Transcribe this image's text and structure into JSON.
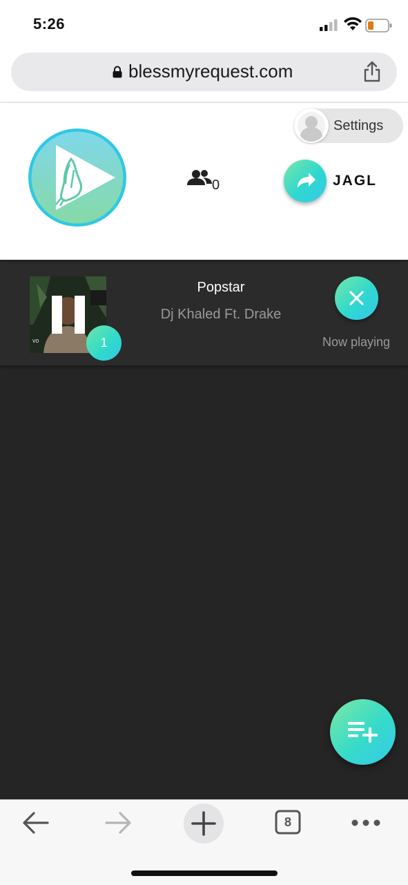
{
  "status_bar": {
    "time": "5:26"
  },
  "browser": {
    "url": "blessmyrequest.com",
    "tabs_count": "8"
  },
  "header": {
    "settings_label": "Settings",
    "listeners_count": "0",
    "room_code": "JAGL"
  },
  "now_playing": {
    "title": "Popstar",
    "artist": "Dj Khaled Ft. Drake",
    "queue_position": "1",
    "status": "Now playing"
  },
  "colors": {
    "accent_start": "#77e7a6",
    "accent_end": "#36c8ea",
    "logo": "#36c6e6",
    "dark_bg": "#252525"
  },
  "icons": [
    "lock-icon",
    "share-icon",
    "settings-avatar-icon",
    "app-logo-icon",
    "listeners-icon",
    "share-arrow-icon",
    "pause-icon",
    "close-icon",
    "add-to-queue-icon",
    "back-arrow-icon",
    "forward-arrow-icon",
    "plus-icon",
    "tabs-icon",
    "more-icon"
  ]
}
